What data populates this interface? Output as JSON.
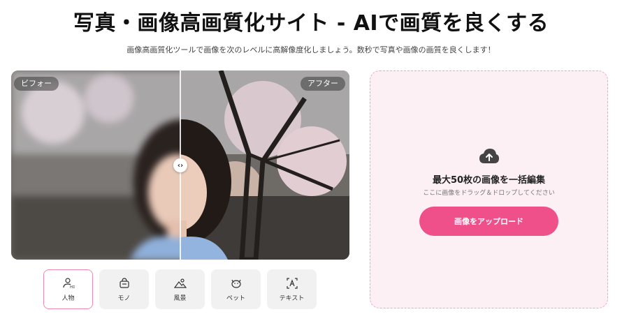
{
  "header": {
    "title": "写真・画像高画質化サイト - AIで画質を良くする",
    "subtitle": "画像高画質化ツールで画像を次のレベルに高解像度化しましょう。数秒で写真や画像の画質を良くします！"
  },
  "compare": {
    "before_label": "ビフォー",
    "after_label": "アフター",
    "handle_glyph": "‹›"
  },
  "tabs": [
    {
      "label": "人物",
      "icon": "person-hd-icon",
      "active": true
    },
    {
      "label": "モノ",
      "icon": "product-icon",
      "active": false
    },
    {
      "label": "風景",
      "icon": "landscape-icon",
      "active": false
    },
    {
      "label": "ペット",
      "icon": "pet-icon",
      "active": false
    },
    {
      "label": "テキスト",
      "icon": "text-icon",
      "active": false
    }
  ],
  "upload": {
    "title": "最大50枚の画像を一括編集",
    "hint": "ここに画像をドラッグ＆ドロップしてください",
    "button_label": "画像をアップロード",
    "icon": "cloud-upload-icon"
  },
  "colors": {
    "accent": "#f0508a",
    "panel_bg": "#fdf0f4",
    "panel_border": "#f2a5bf",
    "active_tab_border": "#f08aa8"
  }
}
